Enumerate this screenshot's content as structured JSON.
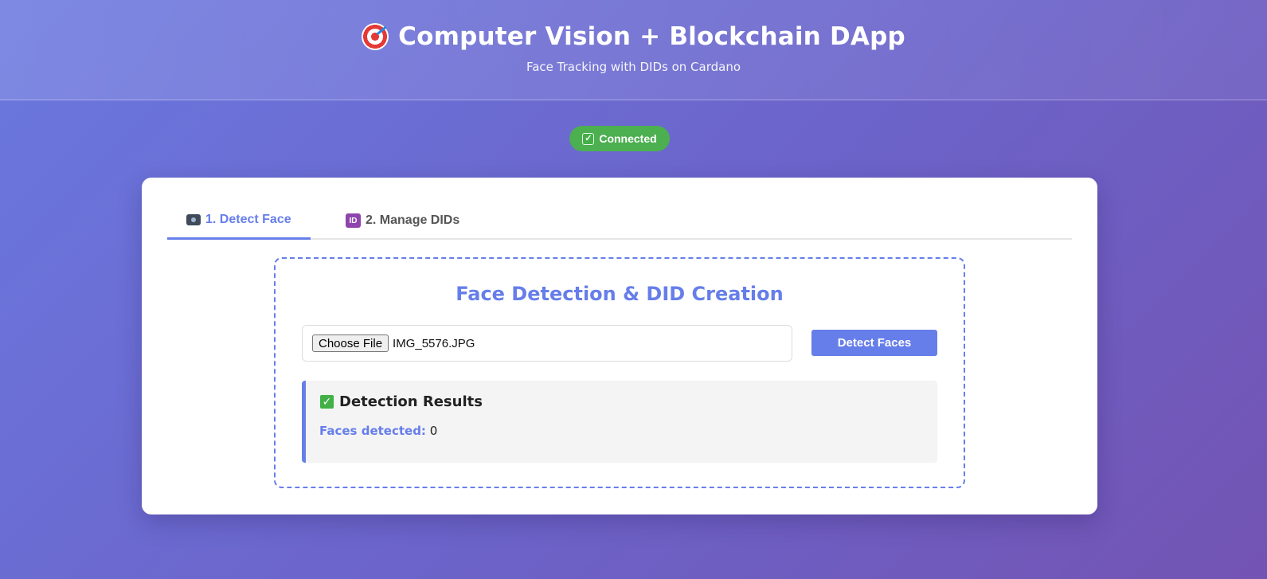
{
  "header": {
    "title": "Computer Vision + Blockchain DApp",
    "subtitle": "Face Tracking with DIDs on Cardano",
    "title_icon": "target-icon"
  },
  "status": {
    "label": "Connected",
    "icon": "check-mark-icon",
    "color": "#4caf50"
  },
  "tabs": [
    {
      "label": "1. Detect Face",
      "icon": "camera-icon",
      "active": true
    },
    {
      "label": "2. Manage DIDs",
      "icon": "id-icon",
      "active": false
    }
  ],
  "detect_panel": {
    "title": "Face Detection & DID Creation",
    "file_button_label": "Choose File",
    "file_name": "IMG_5576.JPG",
    "detect_button_label": "Detect Faces"
  },
  "results": {
    "title": "Detection Results",
    "faces_label": "Faces detected:",
    "faces_count": "0"
  },
  "colors": {
    "accent": "#667eea",
    "success": "#4caf50"
  }
}
